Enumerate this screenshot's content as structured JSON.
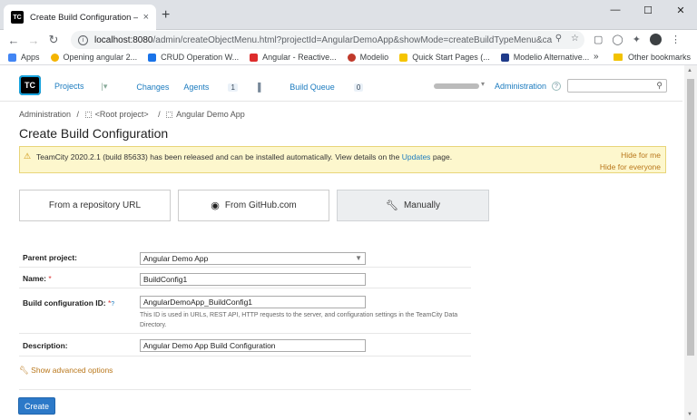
{
  "browser": {
    "tab_icon_text": "TC",
    "tab_title": "Create Build Configuration — Te",
    "tab_close": "×",
    "new_tab": "+",
    "window_controls": {
      "minimize": "—",
      "maximize": "☐",
      "close": "✕"
    },
    "url_host": "localhost:8080",
    "url_path": "/admin/createObjectMenu.html?projectId=AngularDemoApp&showMode=createBuildTypeMenu&ca...",
    "bookmarks": [
      {
        "label": "Apps",
        "color": "#4285f4"
      },
      {
        "label": "Opening angular 2...",
        "color": "#f4b400"
      },
      {
        "label": "CRUD Operation W...",
        "color": "#1a73e8"
      },
      {
        "label": "Angular - Reactive...",
        "color": "#dd2c2c"
      },
      {
        "label": "Modelio",
        "color": "#c0392b"
      },
      {
        "label": "Quick Start Pages (...",
        "color": "#f5c400"
      },
      {
        "label": "Modelio Alternative...",
        "color": "#1f3b8a"
      }
    ],
    "bookmarks_more": "»",
    "other_bookmarks": "Other bookmarks"
  },
  "header": {
    "logo_text": "TC",
    "nav": {
      "projects": "Projects",
      "changes": "Changes",
      "agents": "Agents",
      "agents_count": "1",
      "build_queue": "Build Queue",
      "build_queue_count": "0"
    },
    "administration": "Administration",
    "help": "?"
  },
  "breadcrumb": {
    "administration": "Administration",
    "sep": "/",
    "root_project": "<Root project>",
    "current": "Angular Demo App"
  },
  "page_title": "Create Build Configuration",
  "banner": {
    "text_prefix": "TeamCity 2020.2.1 (build 85633) has been released and can be installed automatically. View details on the",
    "link": "Updates",
    "text_suffix": "page.",
    "hide_for_me": "Hide for me",
    "hide_for_everyone": "Hide for everyone"
  },
  "create_options": {
    "repository_url": "From a repository URL",
    "github": "From GitHub.com",
    "manually": "Manually"
  },
  "form": {
    "parent_project_label": "Parent project:",
    "parent_project_value": "Angular Demo App",
    "name_label": "Name:",
    "name_value": "BuildConfig1",
    "build_id_label": "Build configuration ID:",
    "build_id_value": "AngularDemoApp_BuildConfig1",
    "build_id_note": "This ID is used in URLs, REST API, HTTP requests to the server, and configuration settings in the TeamCity Data Directory.",
    "description_label": "Description:",
    "description_value": "Angular Demo App Build Configuration",
    "required_mark": "*",
    "help_mark": "?"
  },
  "advanced_options": "Show advanced options",
  "create_button": "Create",
  "colors": {
    "link": "#1b7bbf",
    "primary": "#2c79c8",
    "warning_bg": "#fdf7cd",
    "warning_text": "#b9771b"
  }
}
